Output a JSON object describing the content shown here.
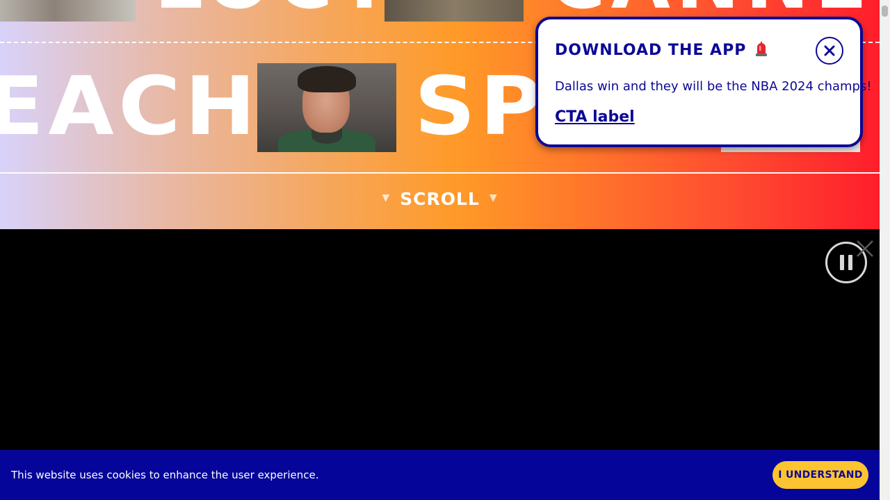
{
  "hero": {
    "word_top_left": "LOCT",
    "word_top_right": "CANNEL",
    "word_each": "EACH",
    "word_sp": "SP",
    "scroll_label": "SCROLL",
    "scroll_arrow": "▼"
  },
  "popup": {
    "title": "DOWNLOAD THE APP",
    "title_icon": "siren-emoji-icon",
    "body": "Dallas win and they will be the NBA 2024 champs!",
    "cta_label": "CTA label",
    "close_icon": "close-circle-icon"
  },
  "video": {
    "pause_icon": "pause-icon",
    "close_icon": "close-icon"
  },
  "cookie": {
    "message": "This website uses cookies to enhance the user experience.",
    "button_label": "I UNDERSTAND"
  },
  "colors": {
    "brand_navy": "#0c0896",
    "cookie_bg": "#06059a",
    "cookie_button": "#fdc431",
    "gradient_start": "#d8d2fa",
    "gradient_mid": "#ff9a28",
    "gradient_end": "#ff1e2c"
  }
}
